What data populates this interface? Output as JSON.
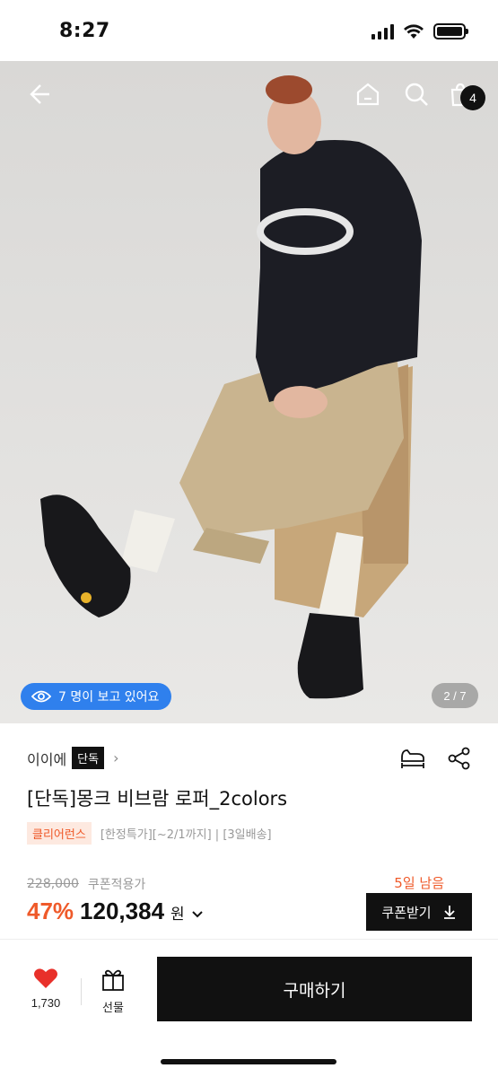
{
  "status_bar": {
    "time": "8:27"
  },
  "hero": {
    "viewers_text": "7 명이 보고 있어요",
    "page_indicator": "2 / 7",
    "cart_count": "4"
  },
  "product": {
    "brand": "이이에",
    "exclusive_tag": "단독",
    "title": "[단독]몽크 비브람 로퍼_2colors",
    "clearance_tag": "클리어런스",
    "extra_tags": "[한정특가][~2/1까지] | [3일배송]",
    "original_price": "228,000",
    "coupon_price_label": "쿠폰적용가",
    "days_left": "5일 남음",
    "discount": "47%",
    "price": "120,384",
    "currency": "원",
    "coupon_button": "쿠폰받기"
  },
  "bottom_bar": {
    "like_count": "1,730",
    "gift_label": "선물",
    "buy_label": "구매하기"
  },
  "colors": {
    "accent_orange": "#ef5a2a",
    "pill_blue": "#2f80ed",
    "heart_red": "#e8302a"
  }
}
